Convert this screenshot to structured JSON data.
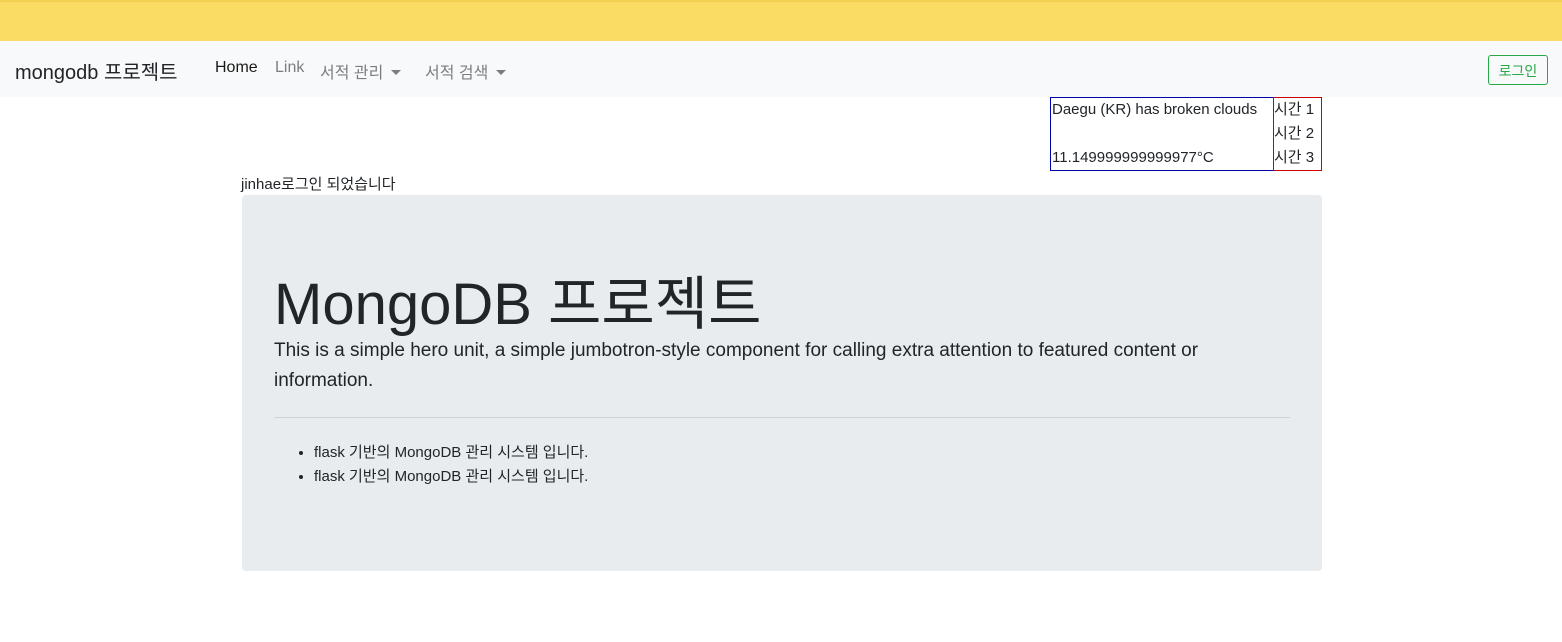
{
  "navbar": {
    "brand": "mongodb 프로젝트",
    "links": [
      {
        "label": "Home"
      },
      {
        "label": "Link"
      },
      {
        "label": "서적 관리"
      },
      {
        "label": "서적 검색"
      }
    ],
    "login_button": "로그인"
  },
  "weather": {
    "description": "Daegu (KR) has broken clouds",
    "temperature": "11.149999999999977°C"
  },
  "times": [
    "시간 1",
    "시간 2",
    "시간 3"
  ],
  "login_message": "jinhae로그인 되었습니다",
  "jumbotron": {
    "title": "MongoDB 프로젝트",
    "lead": "This is a simple hero unit, a simple jumbotron-style component for calling extra attention to featured content or information.",
    "items": [
      "flask 기반의 MongoDB 관리 시스템 입니다.",
      "flask 기반의 MongoDB 관리 시스템 입니다."
    ]
  },
  "colors": {
    "topbar": "#fadb64",
    "navbar_bg": "#f8f9fa",
    "login_button": "#28a745",
    "weather_border": "#0000aa",
    "time_border": "#cc0000",
    "jumbotron_bg": "#e9ecef"
  }
}
